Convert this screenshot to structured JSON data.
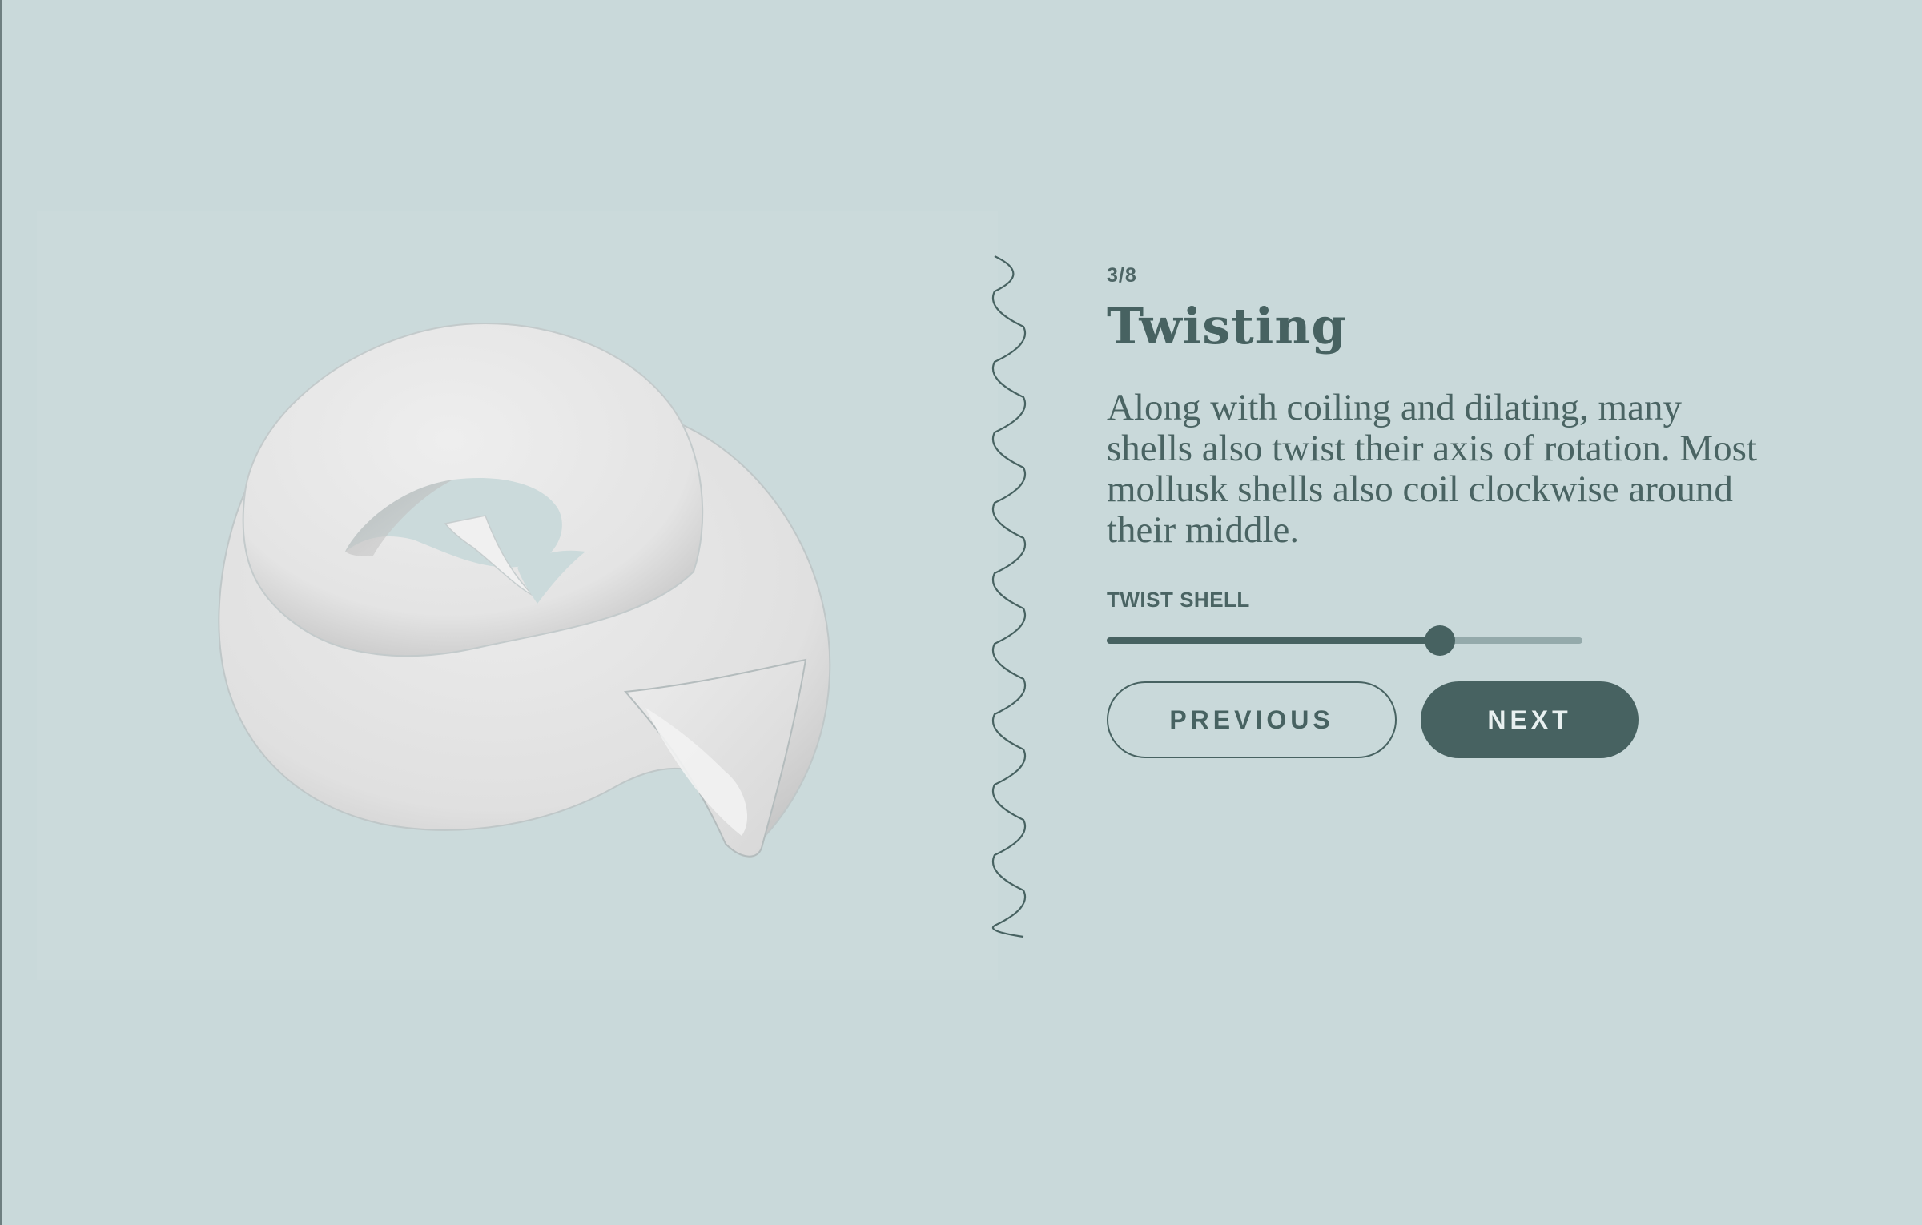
{
  "step": {
    "label": "3/8",
    "current": 3,
    "total": 8
  },
  "title": "Twisting",
  "description": "Along with coiling and dilating, many shells also twist their axis of rotation. Most mollusk shells also coil clockwise around their middle.",
  "slider": {
    "label": "TWIST SHELL",
    "value_fraction": 0.7
  },
  "buttons": {
    "previous": "PREVIOUS",
    "next": "NEXT"
  },
  "colors": {
    "background": "#c9d9da",
    "accent": "#476261",
    "shell": "#e6e6e6"
  },
  "icons": {
    "divider": "wavy-line"
  }
}
